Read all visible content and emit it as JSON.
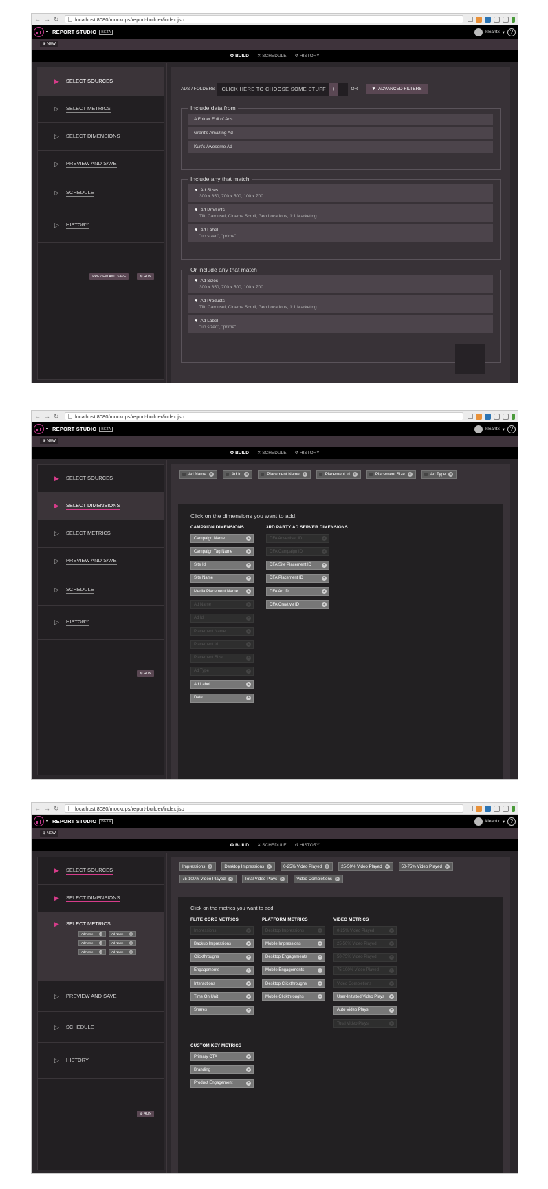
{
  "browser": {
    "url": "localhost:8080/mockups/report-builder/index.jsp"
  },
  "app": {
    "name": "REPORT STUDIO",
    "beta": "BETA",
    "user": "kleantx",
    "help": "?",
    "new_label": "NEW"
  },
  "tabs": {
    "build": "BUILD",
    "schedule": "SCHEDULE",
    "history": "HISTORY"
  },
  "steps": {
    "sources": "SELECT SOURCES",
    "metrics": "SELECT METRICS",
    "dimensions": "SELECT DIMENSIONS",
    "preview": "PREVIEW AND SAVE",
    "schedule": "SCHEDULE",
    "history": "HISTORY",
    "preview_save_btn": "PREVIEW AND SAVE",
    "run_btn": "RUN"
  },
  "sources": {
    "ads_label": "ADS / FOLDERS",
    "chooser_placeholder": "CLICK HERE TO CHOOSE SOME STUFF",
    "or_label": "OR",
    "advanced_filters": "ADVANCED FILTERS",
    "include_from_legend": "Include data from",
    "include_from": [
      "A Folder Full of Ads",
      "Grant's Amazing Ad",
      "Kurt's Awesome Ad"
    ],
    "any_match_legend": "Include any that match",
    "or_any_match_legend": "Or include any that match",
    "rules": [
      {
        "name": "Ad Sizes",
        "value": "300 x 350, 700 x 500, 100 x 700"
      },
      {
        "name": "Ad Products",
        "value": "Tilt, Carousel, Cinema Scroll, Geo Locations, 1:1 Marketing"
      },
      {
        "name": "Ad Label",
        "value": "\"up sized\", \"prime\""
      }
    ]
  },
  "dimensions": {
    "selected": [
      "Ad Name",
      "Ad Id",
      "Placement Name",
      "Placement Id",
      "Placement Size",
      "Ad Type"
    ],
    "prompt": "Click on the dimensions you want to add.",
    "campaign_header": "CAMPAIGN DIMENSIONS",
    "third_party_header": "3RD PARTY AD SERVER DIMENSIONS",
    "campaign": [
      "Campaign Name",
      "Campaign Tag Name",
      "Site Id",
      "Site Name",
      "Media Placement Name",
      "Ad Name",
      "Ad Id",
      "Placement Name",
      "Placement Id",
      "Placement Size",
      "Ad Type",
      "Ad Label",
      "Date"
    ],
    "third_party": [
      "DFA Advertiser ID",
      "DFA Campaign ID",
      "DFA Site Placement ID",
      "DFA Placement ID",
      "DFA Ad ID",
      "DFA Creative ID"
    ]
  },
  "metrics": {
    "selected": [
      "Impressions",
      "Desktop Impressions",
      "0-25% Video Played",
      "25-50% Video Played",
      "50-75% Video Played",
      "75-100% Video Played",
      "Total Video Plays",
      "Video Completions"
    ],
    "prompt": "Click on the metrics you want to add.",
    "core_header": "FLITE CORE METRICS",
    "platform_header": "PLATFORM METRICS",
    "video_header": "VIDEO METRICS",
    "custom_header": "CUSTOM KEY METRICS",
    "core": [
      "Impressions",
      "Backup Impressions",
      "Clickthroughs",
      "Engagements",
      "Interactions",
      "Time On Unit",
      "Shares"
    ],
    "platform": [
      "Desktop Impressions",
      "Mobile Impressions",
      "Desktop Engagements",
      "Mobile Engagements",
      "Desktop Clickthroughs",
      "Mobile Clickthroughs"
    ],
    "video": [
      "0-25% Video Played",
      "25-50% Video Played",
      "50-75% Video Played",
      "75-100% Video Played",
      "Video Completions",
      "User-Initiated Video Plays",
      "Auto Video Plays",
      "Total Video Plays"
    ],
    "custom": [
      "Primary CTA",
      "Branding",
      "Product Engagement"
    ],
    "mini_chip": "Ad Name"
  }
}
